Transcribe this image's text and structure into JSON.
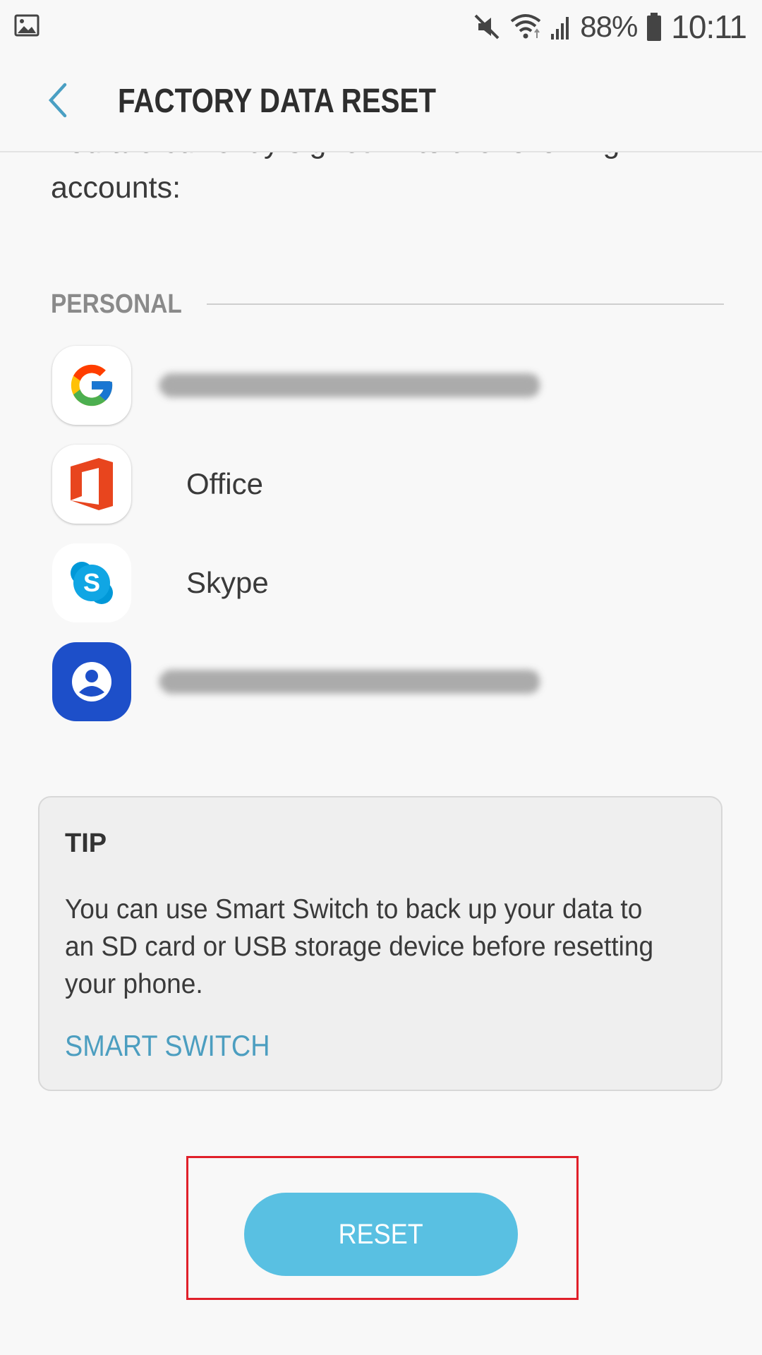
{
  "status_bar": {
    "gallery_icon": "image-notification-icon",
    "mute_icon": "vibrate-mute-icon",
    "wifi_icon": "wifi-icon",
    "signal_icon": "cell-signal-icon",
    "battery_icon": "battery-icon",
    "battery_percent": "88%",
    "time": "10:11"
  },
  "app_bar": {
    "back_icon": "chevron-left-icon",
    "title": "FACTORY DATA RESET"
  },
  "content": {
    "intro": "You are currently signed in to the following accounts:",
    "section_label": "PERSONAL",
    "accounts": [
      {
        "icon": "google-icon",
        "label": "",
        "blurred": true
      },
      {
        "icon": "office-icon",
        "label": "Office",
        "blurred": false
      },
      {
        "icon": "skype-icon",
        "label": "Skype",
        "blurred": false
      },
      {
        "icon": "samsung-account-icon",
        "label": "",
        "blurred": true
      }
    ]
  },
  "tip": {
    "title": "TIP",
    "body": "You can use Smart Switch to back up your data to an SD card or USB storage device before resetting your phone.",
    "link_label": "SMART SWITCH"
  },
  "reset": {
    "label": "RESET"
  },
  "colors": {
    "background": "#f8f8f8",
    "accent_link": "#4c9ec0",
    "reset_button": "#59c0e2",
    "highlight_border": "#e0202a"
  }
}
